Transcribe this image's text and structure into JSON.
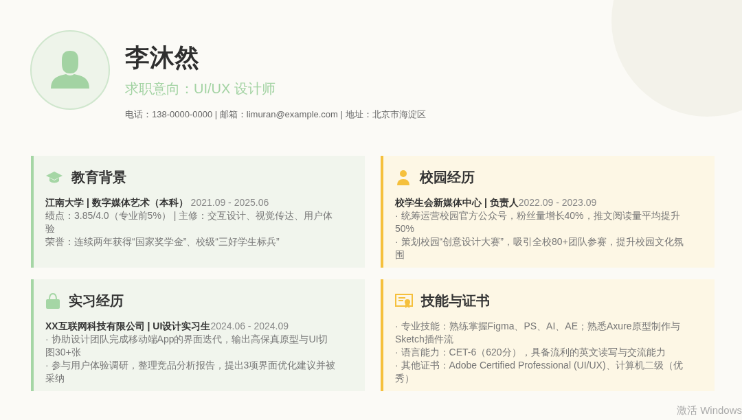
{
  "profile": {
    "name": "李沐然",
    "objective": "求职意向：UI/UX 设计师",
    "contact": "电话：138-0000-0000 | 邮箱：limuran@example.com | 地址：北京市海淀区"
  },
  "sections": [
    {
      "title": "教育背景",
      "color": "#a5d6a5",
      "entries": [
        {
          "heading": "**江南大学 | 数字媒体艺术（本科）** 2021.09 - 2025.06",
          "lines": [
            "绩点：3.85/4.0（专业前5%）  | 主修：交互设计、视觉传达、用户体验",
            "荣誉：连续两年获得“国家奖学金”、校级“三好学生标兵”"
          ]
        }
      ]
    },
    {
      "title": "校园经历",
      "color": "#f5c03c",
      "entries": [
        {
          "heading": "**校学生会新媒体中心 | 负责人**2022.09 - 2023.09",
          "lines": [
            "· 统筹运营校园官方公众号，粉丝量增长40%，推文阅读量平均提升50%",
            "· 策划校园“创意设计大赛”，吸引全校80+团队参赛，提升校园文化氛围"
          ]
        }
      ]
    },
    {
      "title": "实习经历",
      "color": "#a5d6a5",
      "entries": [
        {
          "heading": "**XX互联网科技有限公司 | UI设计实习生**2024.06 - 2024.09",
          "lines": [
            "· 协助设计团队完成移动端App的界面迭代，输出高保真原型与UI切图30+张",
            "· 参与用户体验调研，整理竞品分析报告，提出3项界面优化建议并被采纳"
          ]
        }
      ]
    },
    {
      "title": "技能与证书",
      "color": "#f5c03c",
      "entries": [
        {
          "lines": [
            "· 专业技能：熟练掌握Figma、PS、AI、AE；熟悉Axure原型制作与Sketch插件流",
            "· 语言能力：CET-6（620分），具备流利的英文读写与交流能力",
            "· 其他证书：Adobe Certified Professional (UI/UX)、计算机二级（优秀）"
          ]
        }
      ]
    }
  ],
  "system_notice": "激活 Windows"
}
